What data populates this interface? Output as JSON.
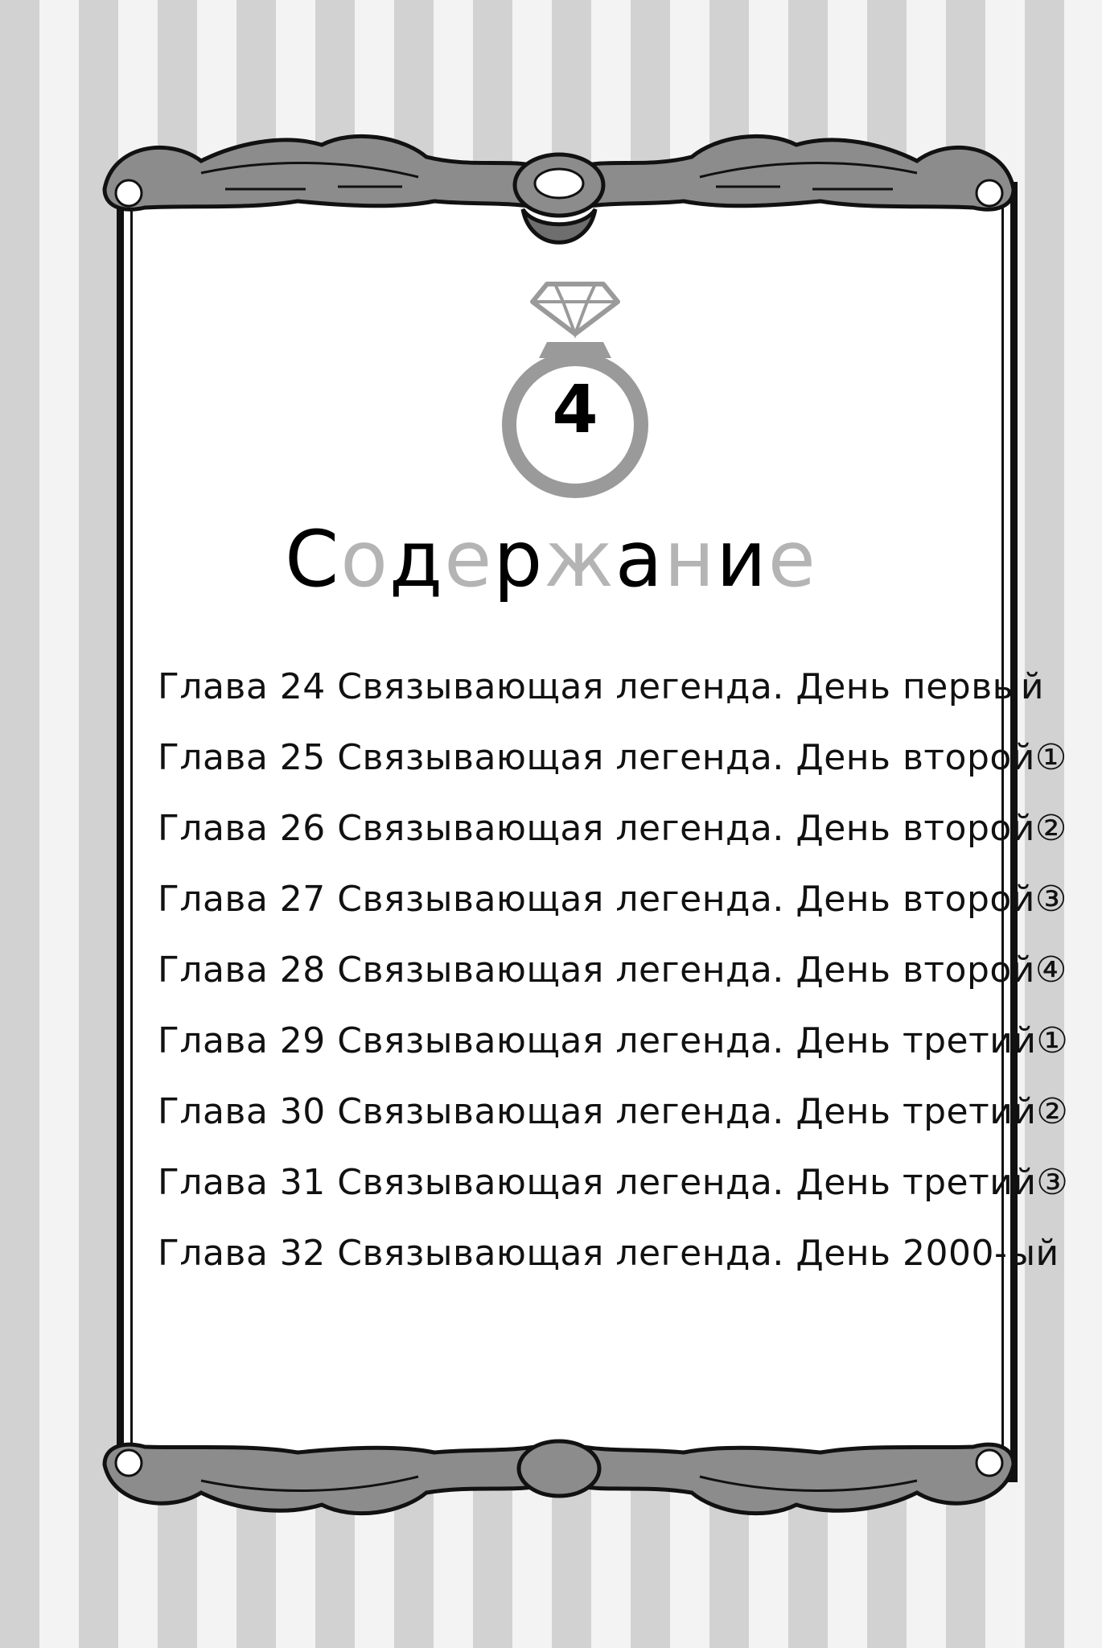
{
  "volume_number": "4",
  "title_letters": [
    {
      "char": "С",
      "tone": "dark"
    },
    {
      "char": "о",
      "tone": "light"
    },
    {
      "char": "д",
      "tone": "dark"
    },
    {
      "char": "е",
      "tone": "light"
    },
    {
      "char": "р",
      "tone": "dark"
    },
    {
      "char": "ж",
      "tone": "light"
    },
    {
      "char": "а",
      "tone": "dark"
    },
    {
      "char": "н",
      "tone": "light"
    },
    {
      "char": "и",
      "tone": "dark"
    },
    {
      "char": "е",
      "tone": "light"
    }
  ],
  "toc": [
    "Глава 24 Связывающая легенда. День первый",
    "Глава 25 Связывающая легенда. День второй①",
    "Глава 26 Связывающая легенда. День второй②",
    "Глава 27 Связывающая легенда. День второй③",
    "Глава 28 Связывающая легенда. День второй④",
    "Глава 29 Связывающая легенда. День третий①",
    "Глава 30 Связывающая легенда. День третий②",
    "Глава 31 Связывающая легенда. День третий③",
    "Глава 32 Связывающая легенда. День 2000-ый"
  ],
  "colors": {
    "stripe_dark": "#d2d2d2",
    "stripe_light": "#f3f3f3",
    "ornament_fill": "#8c8c8c",
    "ring_gray": "#9a9a9a",
    "title_light": "#b4b4b4"
  }
}
